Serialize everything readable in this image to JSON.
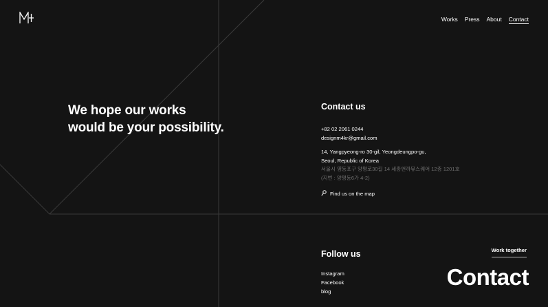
{
  "logo": {
    "text": "M4",
    "icon": "m4-logo-icon"
  },
  "nav": {
    "items": [
      {
        "label": "Works"
      },
      {
        "label": "Press"
      },
      {
        "label": "About"
      },
      {
        "label": "Contact",
        "active": true
      }
    ]
  },
  "hero": {
    "line1": "We hope our works",
    "line2": "would be your possibility."
  },
  "contact": {
    "title": "Contact us",
    "phone": "+82 02 2061 0244",
    "email": "designm4kr@gmail.com",
    "address_line1": "14, Yangpyeong-ro 30-gil, Yeongdeungpo-gu,",
    "address_line2": "Seoul, Republic of Korea",
    "address_kr1": "서울시 영등포구 양평로30길 14 세종앤까뮤스퀘어 12층 1201호",
    "address_kr2": "(지번 : 양평동6가 4-2)",
    "map_link": "Find us on the map",
    "map_icon": "map-pin-icon"
  },
  "follow": {
    "title": "Follow us",
    "links": [
      "Instagram",
      "Facebook",
      "blog"
    ]
  },
  "cta": {
    "kicker": "Work together",
    "heading": "Contact"
  },
  "colors": {
    "background": "#141414",
    "text": "#ffffff",
    "dim_text": "#6f6f6f",
    "line": "#3a3a3a"
  }
}
